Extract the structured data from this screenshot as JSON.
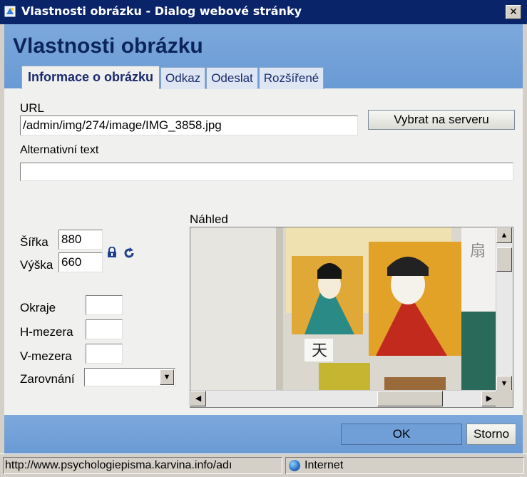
{
  "window": {
    "title": "Vlastnosti obrázku - Dialog webové stránky",
    "close_glyph": "✕"
  },
  "dialog": {
    "title": "Vlastnosti obrázku",
    "tabs": [
      {
        "label": "Informace o obrázku",
        "active": true
      },
      {
        "label": "Odkaz",
        "active": false
      },
      {
        "label": "Odeslat",
        "active": false
      },
      {
        "label": "Rozšířené",
        "active": false
      }
    ]
  },
  "form": {
    "url_label": "URL",
    "url_value": "/admin/img/274/image/IMG_3858.jpg",
    "browse_button": "Vybrat na serveru",
    "alt_label": "Alternativní text",
    "alt_value": "",
    "width_label": "Šířka",
    "width_value": "880",
    "height_label": "Výška",
    "height_value": "660",
    "border_label": "Okraje",
    "border_value": "",
    "hspace_label": "H-mezera",
    "hspace_value": "",
    "vspace_label": "V-mezera",
    "vspace_value": "",
    "align_label": "Zarovnání",
    "align_value": "",
    "preview_label": "Náhled"
  },
  "buttons": {
    "ok": "OK",
    "cancel": "Storno"
  },
  "statusbar": {
    "url": "http://www.psychologiepisma.karvina.info/adı",
    "zone": "Internet"
  },
  "colors": {
    "titlebar": "#0a246a",
    "header": "#6f9fd6",
    "title_text": "#0b245c"
  }
}
